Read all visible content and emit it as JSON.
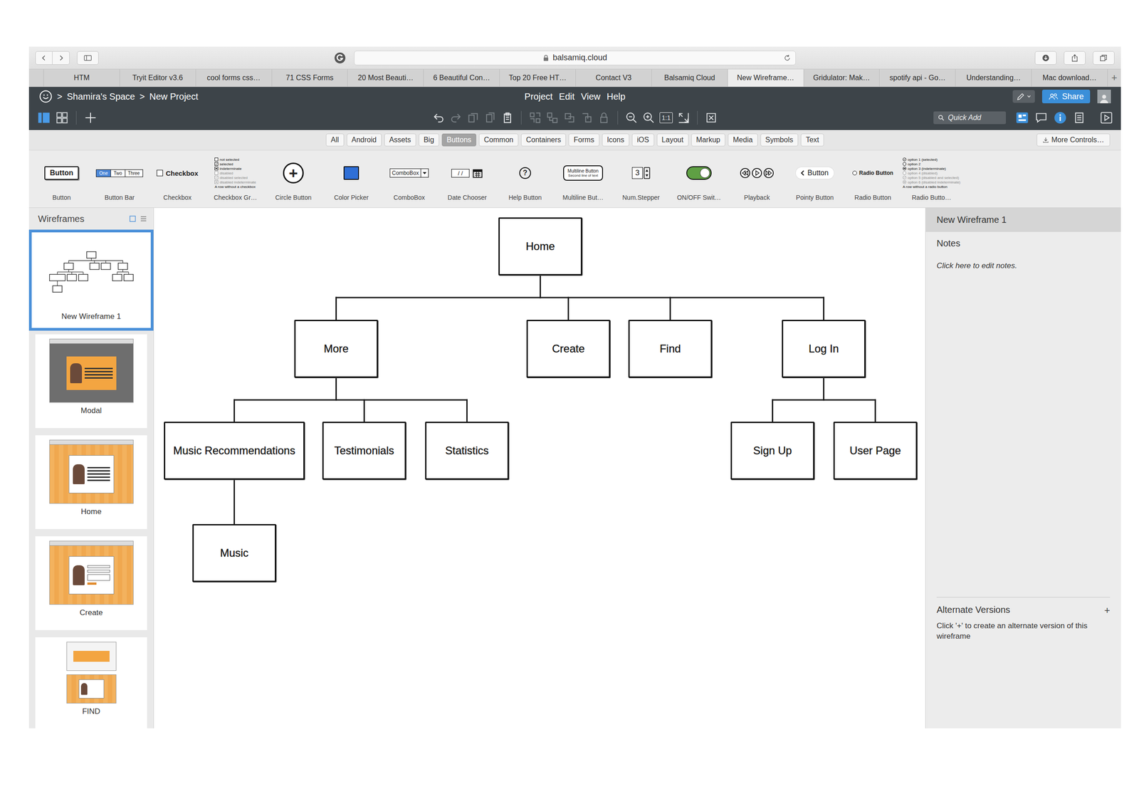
{
  "browser": {
    "url": "balsamiq.cloud",
    "tabs": [
      {
        "label": "HTM",
        "selected": false
      },
      {
        "label": "Tryit Editor v3.6",
        "selected": false
      },
      {
        "label": "cool forms css…",
        "selected": false
      },
      {
        "label": "71 CSS Forms",
        "selected": false
      },
      {
        "label": "20 Most Beauti…",
        "selected": false
      },
      {
        "label": "6 Beautiful Con…",
        "selected": false
      },
      {
        "label": "Top 20 Free HT…",
        "selected": false
      },
      {
        "label": "Contact V3",
        "selected": false
      },
      {
        "label": "Balsamiq Cloud",
        "selected": false
      },
      {
        "label": "New Wireframe…",
        "selected": true
      },
      {
        "label": "Gridulator: Mak…",
        "selected": false
      },
      {
        "label": "spotify api - Go…",
        "selected": false
      },
      {
        "label": "Understanding…",
        "selected": false
      },
      {
        "label": "Mac download…",
        "selected": false
      }
    ],
    "new_tab": "+"
  },
  "app": {
    "separator": ">",
    "breadcrumb": [
      "Shamira's Space",
      "New Project"
    ],
    "menu": [
      "Project",
      "Edit",
      "View",
      "Help"
    ],
    "share": "Share",
    "view_modes": [
      {
        "kind": "single",
        "selected": true
      },
      {
        "kind": "grid",
        "selected": false
      }
    ],
    "tools": [
      {
        "kind": "undo",
        "disabled": false
      },
      {
        "kind": "redo",
        "disabled": true
      },
      {
        "kind": "duplicate",
        "disabled": true
      },
      {
        "kind": "copy",
        "disabled": true
      },
      {
        "kind": "paste",
        "disabled": false
      },
      {
        "kind": "group",
        "disabled": true
      },
      {
        "kind": "ungroup",
        "disabled": true
      },
      {
        "kind": "front",
        "disabled": true
      },
      {
        "kind": "back",
        "disabled": true
      },
      {
        "kind": "lock",
        "disabled": true
      },
      {
        "kind": "zoom-out",
        "disabled": false
      },
      {
        "kind": "zoom-in",
        "disabled": false
      }
    ],
    "zoom_reset": "1:1",
    "quick_add": {
      "placeholder": "Quick Add"
    }
  },
  "library": {
    "categories": [
      {
        "label": "All",
        "selected": false
      },
      {
        "label": "Android",
        "selected": false
      },
      {
        "label": "Assets",
        "selected": false
      },
      {
        "label": "Big",
        "selected": false
      },
      {
        "label": "Buttons",
        "selected": true
      },
      {
        "label": "Common",
        "selected": false
      },
      {
        "label": "Containers",
        "selected": false
      },
      {
        "label": "Forms",
        "selected": false
      },
      {
        "label": "Icons",
        "selected": false
      },
      {
        "label": "iOS",
        "selected": false
      },
      {
        "label": "Layout",
        "selected": false
      },
      {
        "label": "Markup",
        "selected": false
      },
      {
        "label": "Media",
        "selected": false
      },
      {
        "label": "Symbols",
        "selected": false
      },
      {
        "label": "Text",
        "selected": false
      }
    ],
    "more": "More Controls…",
    "controls": [
      {
        "label": "Button",
        "kind": "button",
        "text": "Button"
      },
      {
        "label": "Button Bar",
        "kind": "buttonbar",
        "segments": [
          {
            "text": "One",
            "selected": true
          },
          {
            "text": "Two",
            "selected": false
          },
          {
            "text": "Three",
            "selected": false
          }
        ]
      },
      {
        "label": "Checkbox",
        "kind": "checkbox",
        "text": "Checkbox",
        "checked": false
      },
      {
        "label": "Checkbox Gr…",
        "kind": "checkgroup",
        "options": [
          {
            "text": "not selected",
            "state": "off"
          },
          {
            "text": "selected",
            "state": "on"
          },
          {
            "text": "indeterminate",
            "state": "mixed"
          },
          {
            "text": "disabled",
            "state": "disabled"
          },
          {
            "text": "disabled selected",
            "state": "disabled-on"
          },
          {
            "text": "disabled indeterminate",
            "state": "disabled-mixed"
          },
          {
            "text": "A row without a checkbox",
            "state": "none"
          }
        ]
      },
      {
        "label": "Circle Button",
        "kind": "circle",
        "text": "+"
      },
      {
        "label": "Color Picker",
        "kind": "color",
        "color": "#2f6fd6"
      },
      {
        "label": "ComboBox",
        "kind": "combo",
        "text": "ComboBox"
      },
      {
        "label": "Date Chooser",
        "kind": "date",
        "text": "/ /"
      },
      {
        "label": "Help Button",
        "kind": "help",
        "text": "?"
      },
      {
        "label": "Multiline But…",
        "kind": "multiline",
        "lines": [
          "Multiline Button",
          "Second line of text"
        ]
      },
      {
        "label": "Num.Stepper",
        "kind": "stepper",
        "text": "3"
      },
      {
        "label": "ON/OFF Swit…",
        "kind": "switch",
        "on": true
      },
      {
        "label": "Playback",
        "kind": "playback"
      },
      {
        "label": "Pointy Button",
        "kind": "pointy",
        "text": "Button"
      },
      {
        "label": "Radio Button",
        "kind": "radio",
        "text": "Radio Button",
        "selected": false
      },
      {
        "label": "Radio Butto…",
        "kind": "radiogroup",
        "options": [
          {
            "text": "option 1 (selected)",
            "state": "on"
          },
          {
            "text": "option 2",
            "state": "off"
          },
          {
            "text": "option 3 (indeterminate)",
            "state": "mixed"
          },
          {
            "text": "option 4 (disabled)",
            "state": "disabled"
          },
          {
            "text": "option 5 (disabled and selected)",
            "state": "disabled-on"
          },
          {
            "text": "option 6 (disabled indeterminate)",
            "state": "disabled-mixed"
          },
          {
            "text": "A row without a radio button",
            "state": "none"
          }
        ]
      }
    ]
  },
  "sidebar": {
    "title": "Wireframes",
    "items": [
      {
        "label": "New Wireframe 1",
        "kind": "tree",
        "selected": true
      },
      {
        "label": "Modal",
        "kind": "modal",
        "selected": false
      },
      {
        "label": "Home",
        "kind": "page",
        "selected": false
      },
      {
        "label": "Create",
        "kind": "form",
        "selected": false
      },
      {
        "label": "FIND",
        "kind": "stack",
        "selected": false
      }
    ]
  },
  "canvas": {
    "tree": {
      "label": "Home",
      "children": [
        {
          "label": "More",
          "children": [
            {
              "label": "Music Recommendations",
              "children": [
                {
                  "label": "Music"
                }
              ]
            },
            {
              "label": "Testimonials"
            },
            {
              "label": "Statistics"
            }
          ]
        },
        {
          "label": "Create"
        },
        {
          "label": "Find"
        },
        {
          "label": "Log In",
          "children": [
            {
              "label": "Sign Up"
            },
            {
              "label": "User Page"
            }
          ]
        }
      ]
    }
  },
  "inspector": {
    "title": "New Wireframe 1",
    "notes_label": "Notes",
    "notes_placeholder": "Click here to edit notes.",
    "alt_title": "Alternate Versions",
    "alt_add": "+",
    "alt_hint": "Click '+' to create an alternate version of this wireframe"
  }
}
